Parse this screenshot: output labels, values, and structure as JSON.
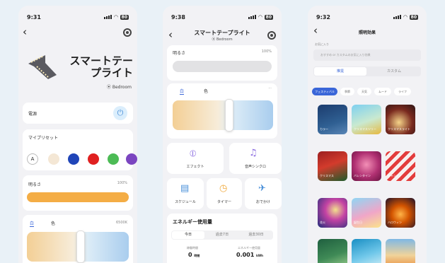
{
  "screen1": {
    "time": "9:31",
    "title_line1": "スマートテー",
    "title_line2": "プライト",
    "room": "Bedroom",
    "power_label": "電源",
    "preset_label": "マイプリセット",
    "preset_auto": "A",
    "presets": [
      "#f4e7d5",
      "#2045b8",
      "#e02020",
      "#4cbb55",
      "#7b45c0"
    ],
    "brightness_label": "明るさ",
    "brightness_value": "100%",
    "brightness_level": 1.0,
    "tab_white": "白",
    "tab_color": "色",
    "color_temp": "6500K"
  },
  "screen2": {
    "time": "9:38",
    "title": "スマートテープライト",
    "room": "Bedroom",
    "brightness_label": "明るさ",
    "brightness_value": "100%",
    "tab_white": "白",
    "tab_color": "色",
    "more": "···",
    "functions": [
      {
        "icon": "effect-icon",
        "label": "エフェクト"
      },
      {
        "icon": "music-icon",
        "label": "音声シンクロ"
      },
      {
        "icon": "schedule-icon",
        "label": "スケジュール"
      },
      {
        "icon": "timer-icon",
        "label": "タイマー"
      },
      {
        "icon": "away-icon",
        "label": "おでかけ"
      }
    ],
    "energy_title": "エネルギー使用量",
    "energy_tabs": [
      "今日",
      "過去7日",
      "過去30日"
    ],
    "energy_left_label": "稼働時間",
    "energy_left_value": "0",
    "energy_left_unit": "時間",
    "energy_right_label": "エネルギー使用量",
    "energy_right_value": "0.001",
    "energy_right_unit": "kWh"
  },
  "screen3": {
    "time": "9:32",
    "title": "照明効果",
    "favorites_label": "お気に入り",
    "favorites_placeholder": "おすすめ or カスタムのお気に入り効果",
    "tab_recommended": "推奨",
    "tab_custom": "カスタム",
    "categories": [
      "フェスティバル",
      "季節",
      "天気",
      "ムード",
      "ライフ"
    ],
    "effects": [
      {
        "label": "カラー"
      },
      {
        "label": "クリスマスツリー"
      },
      {
        "label": "クリスマスライト"
      },
      {
        "label": "クリスマス"
      },
      {
        "label": "バレンタイン"
      },
      {
        "label": "キャンディ"
      },
      {
        "label": "花火"
      },
      {
        "label": "誕生日"
      },
      {
        "label": "ハロウィン"
      },
      {
        "label": ""
      },
      {
        "label": ""
      },
      {
        "label": ""
      }
    ]
  }
}
